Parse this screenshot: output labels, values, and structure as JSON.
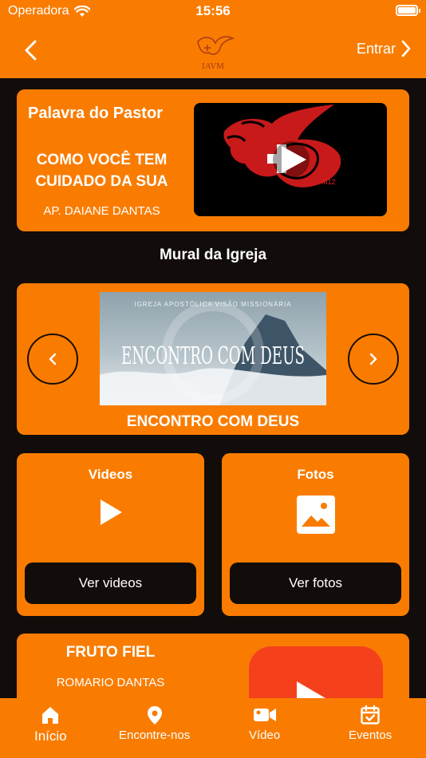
{
  "status": {
    "carrier": "Operadora",
    "time": "15:56"
  },
  "nav": {
    "login_label": "Entrar",
    "logo_text": "IAVM"
  },
  "pastor": {
    "title": "Palavra do Pastor",
    "headline_line1": "COMO VOCÊ TEM",
    "headline_line2": "CUIDADO DA SUA",
    "author": "AP. DAIANE DANTAS",
    "video_mark": "M12"
  },
  "mural": {
    "title": "Mural da Igreja",
    "banner_top": "IGREJA APOSTÓLICA VISÃO MISSIONÁRIA",
    "banner_text": "ENCONTRO COM DEUS",
    "caption": "ENCONTRO COM DEUS"
  },
  "videos": {
    "label": "Videos",
    "button": "Ver videos"
  },
  "fotos": {
    "label": "Fotos",
    "button": "Ver fotos"
  },
  "fruto": {
    "title": "FRUTO FIEL",
    "author": "ROMARIO DANTAS"
  },
  "tabs": [
    {
      "label": "Início",
      "icon": "home-icon"
    },
    {
      "label": "Encontre-nos",
      "icon": "location-pin-icon"
    },
    {
      "label": "Vídeo",
      "icon": "video-camera-icon"
    },
    {
      "label": "Eventos",
      "icon": "calendar-icon"
    }
  ],
  "colors": {
    "accent": "#f97c00",
    "background": "#120d0b",
    "youtube": "#f4411c"
  }
}
